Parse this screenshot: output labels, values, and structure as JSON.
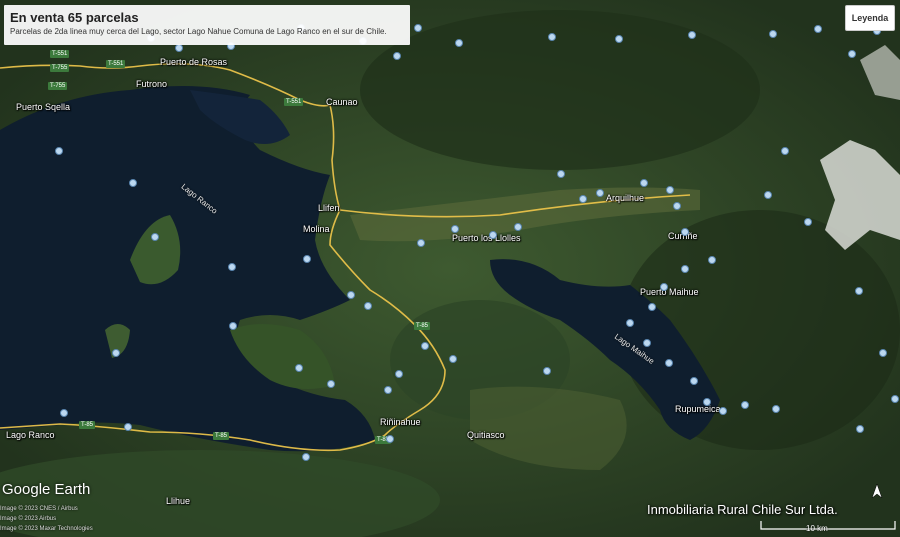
{
  "header": {
    "title": "En venta 65 parcelas",
    "subtitle": "Parcelas de 2da linea muy cerca del Lago, sector Lago Nahue Comuna de Lago Ranco en el sur de Chile."
  },
  "legend_button": {
    "label": "Leyenda"
  },
  "places": [
    {
      "label": "Puerto de Rosas"
    },
    {
      "label": "Futrono"
    },
    {
      "label": "Puerto Sqella"
    },
    {
      "label": "Caunao"
    },
    {
      "label": "Llifen"
    },
    {
      "label": "Molina"
    },
    {
      "label": "Puerto los Llolles"
    },
    {
      "label": "Arquilhue"
    },
    {
      "label": "Curriñe"
    },
    {
      "label": "Puerto Maihue"
    },
    {
      "label": "Rupumeica"
    },
    {
      "label": "Riñinahue"
    },
    {
      "label": "Quitiasco"
    },
    {
      "label": "Lago Ranco"
    },
    {
      "label": "Llihue"
    }
  ],
  "lakes": [
    {
      "label": "Lago Ranco"
    },
    {
      "label": "Lago Maihue"
    }
  ],
  "routes": [
    {
      "label": "T-551"
    },
    {
      "label": "T-551"
    },
    {
      "label": "T-755"
    },
    {
      "label": "T-755"
    },
    {
      "label": "T-551"
    },
    {
      "label": "T-85"
    },
    {
      "label": "T-85"
    },
    {
      "label": "T-85"
    },
    {
      "label": "T-85"
    }
  ],
  "branding": {
    "logo": "Google Earth",
    "watermark": "Inmobiliaria Rural Chile Sur Ltda.",
    "attributions": [
      "Image © 2023 CNES / Airbus",
      "Image © 2023 Airbus",
      "Image © 2023 Maxar Technologies"
    ],
    "scale_label": "10 km"
  },
  "icons": {
    "north_arrow": "north-arrow-icon",
    "marker": "parcel-marker-icon"
  },
  "colors": {
    "road": "#e9c24a",
    "lake": "#0f1e2e",
    "terrain": "#2e4627",
    "marker": "#bcd8f0"
  }
}
